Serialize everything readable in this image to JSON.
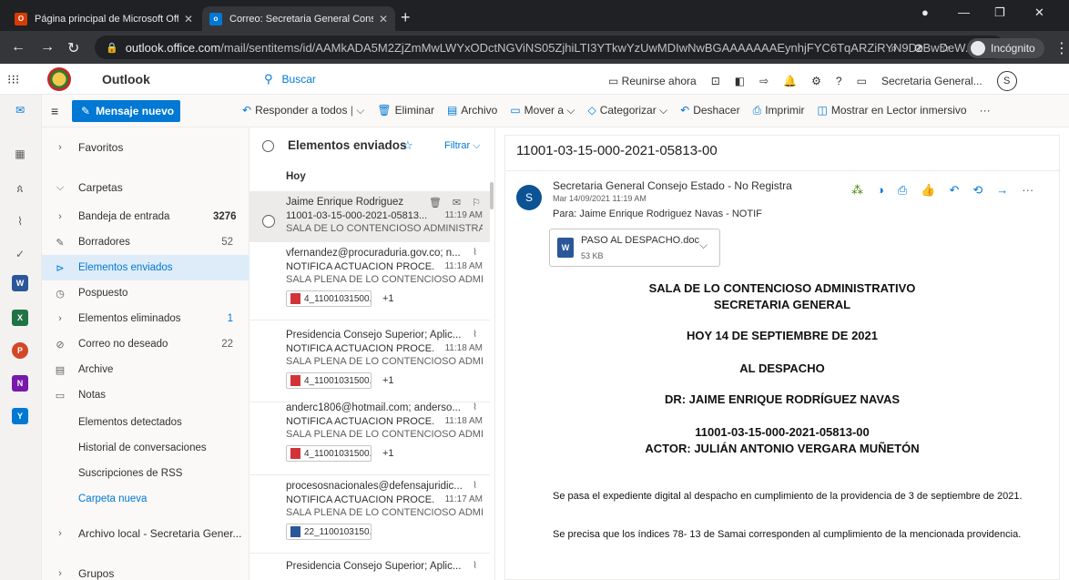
{
  "browser": {
    "tabs": [
      {
        "title": "Página principal de Microsoft Off",
        "icon": "office-icon"
      },
      {
        "title": "Correo: Secretaria General Conse",
        "icon": "outlook-icon"
      }
    ],
    "url_host": "outlook.office.com",
    "url_path": "/mail/sentitems/id/AAMkADA5M2ZjZmMwLWYxODctNGViNS05ZjhiLTI3YTkwYzUwMDIwNwBGAAAAAAAEynhjFYC6TqARZiRYN9DzBwDeW...",
    "incognito_label": "Incógnito"
  },
  "outlook": {
    "brand": "Outlook",
    "search_placeholder": "Buscar",
    "meet_now": "Reunirse ahora",
    "account": "Secretaria General...",
    "account_initial": "S",
    "new_message": "Mensaje nuevo"
  },
  "commands": {
    "reply_all": "Responder a todos",
    "delete": "Eliminar",
    "archive": "Archivo",
    "move_to": "Mover a",
    "categorize": "Categorizar",
    "undo": "Deshacer",
    "print": "Imprimir",
    "immersive": "Mostrar en Lector inmersivo",
    "more": "···"
  },
  "folders": {
    "favorites": "Favoritos",
    "folders_head": "Carpetas",
    "items": [
      {
        "name": "Bandeja de entrada",
        "count": "3276"
      },
      {
        "name": "Borradores",
        "count": "52"
      },
      {
        "name": "Elementos enviados",
        "count": ""
      },
      {
        "name": "Pospuesto",
        "count": ""
      },
      {
        "name": "Elementos eliminados",
        "count": "1"
      },
      {
        "name": "Correo no deseado",
        "count": "22"
      },
      {
        "name": "Archive",
        "count": ""
      },
      {
        "name": "Notas",
        "count": ""
      },
      {
        "name": "Elementos detectados",
        "count": ""
      },
      {
        "name": "Historial de conversaciones",
        "count": ""
      },
      {
        "name": "Suscripciones de RSS",
        "count": ""
      }
    ],
    "new_folder": "Carpeta nueva",
    "local_archive": "Archivo local - Secretaria Gener...",
    "groups": "Grupos"
  },
  "message_list": {
    "title": "Elementos enviados",
    "filter": "Filtrar",
    "group": "Hoy",
    "messages": [
      {
        "from": "Jaime Enrique Rodriguez...",
        "subject": "11001-03-15-000-2021-05813...",
        "time": "11:19 AM",
        "preview": "SALA DE LO CONTENCIOSO ADMINISTRA..."
      },
      {
        "from": "vfernandez@procuraduria.gov.co; n...",
        "subject": "NOTIFICA ACTUACION PROCE...",
        "time": "11:18 AM",
        "preview": "SALA PLENA DE LO CONTENCIOSO ADMI...",
        "attachment": "4_11001031500...",
        "more": "+1"
      },
      {
        "from": "Presidencia Consejo Superior; Aplic...",
        "subject": "NOTIFICA ACTUACION PROCE...",
        "time": "11:18 AM",
        "preview": "SALA PLENA DE LO CONTENCIOSO ADMI...",
        "attachment": "4_11001031500...",
        "more": "+1"
      },
      {
        "from": "anderc1806@hotmail.com; anderso...",
        "subject": "NOTIFICA ACTUACION PROCE...",
        "time": "11:18 AM",
        "preview": "SALA PLENA DE LO CONTENCIOSO ADMI...",
        "attachment": "4_11001031500...",
        "more": "+1"
      },
      {
        "from": "procesosnacionales@defensajuridic...",
        "subject": "NOTIFICA ACTUACION PROCE...",
        "time": "11:17 AM",
        "preview": "SALA PLENA DE LO CONTENCIOSO ADMI...",
        "attachment": "22_1100103150...",
        "more": ""
      },
      {
        "from": "Presidencia Consejo Superior; Aplic...",
        "subject": "",
        "time": "",
        "preview": ""
      }
    ]
  },
  "reading": {
    "subject": "11001-03-15-000-2021-05813-00",
    "avatar": "S",
    "from": "Secretaria General Consejo Estado - No Registra",
    "date": "Mar 14/09/2021 11:19 AM",
    "to": "Para: Jaime Enrique Rodriguez Navas - NOTIF",
    "attachment_name": "PASO AL DESPACHO.doc",
    "attachment_size": "53 KB",
    "body": {
      "h1": "SALA DE LO CONTENCIOSO ADMINISTRATIVO",
      "h2": "SECRETARIA GENERAL",
      "h3": "HOY 14  DE SEPTIEMBRE DE 2021",
      "h4": "AL DESPACHO",
      "h5": "DR: JAIME ENRIQUE RODRÍGUEZ NAVAS",
      "h6": "11001-03-15-000-2021-05813-00",
      "h7": "ACTOR:  JULIÁN ANTONIO VERGARA MUÑETÓN",
      "p1": "Se pasa el expediente digital al despacho en cumplimiento de la providencia de 3 de septiembre de 2021.",
      "p2": "Se precisa que los índices 78- 13 de Samai corresponden al cumplimiento de la mencionada providencia."
    }
  }
}
